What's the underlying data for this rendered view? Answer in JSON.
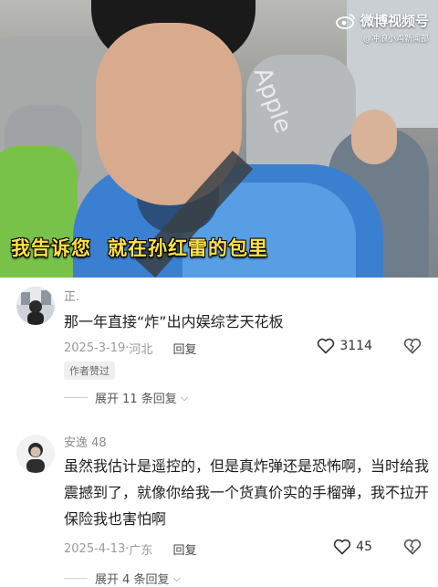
{
  "video": {
    "subtitle_part1": "我告诉您",
    "subtitle_part2": "就在孙红雷的包里",
    "seat_brand_text": "Apple"
  },
  "watermark": {
    "title": "微博视频号",
    "handle": "@冲浪小鸡新闻部"
  },
  "comments": [
    {
      "username": "正.",
      "text": "那一年直接“炸”出内娱综艺天花板",
      "date": "2025-3-19",
      "location": "河北",
      "reply_label": "回复",
      "likes": "3114",
      "badge": "作者赞过",
      "expand_label": "展开 11 条回复"
    },
    {
      "username": "安逸 48",
      "text": "虽然我估计是遥控的，但是真炸弹还是恐怖啊，当时给我震撼到了，就像你给我一个货真价实的手榴弹，我不拉开保险我也害怕啊",
      "date": "2025-4-13",
      "location": "广东",
      "reply_label": "回复",
      "likes": "45",
      "expand_label": "展开 4 条回复"
    }
  ],
  "icons": {
    "like": "heart-outline-icon",
    "dislike": "broken-heart-icon",
    "expand": "chevron-down-icon",
    "weibo": "weibo-eye-logo"
  }
}
